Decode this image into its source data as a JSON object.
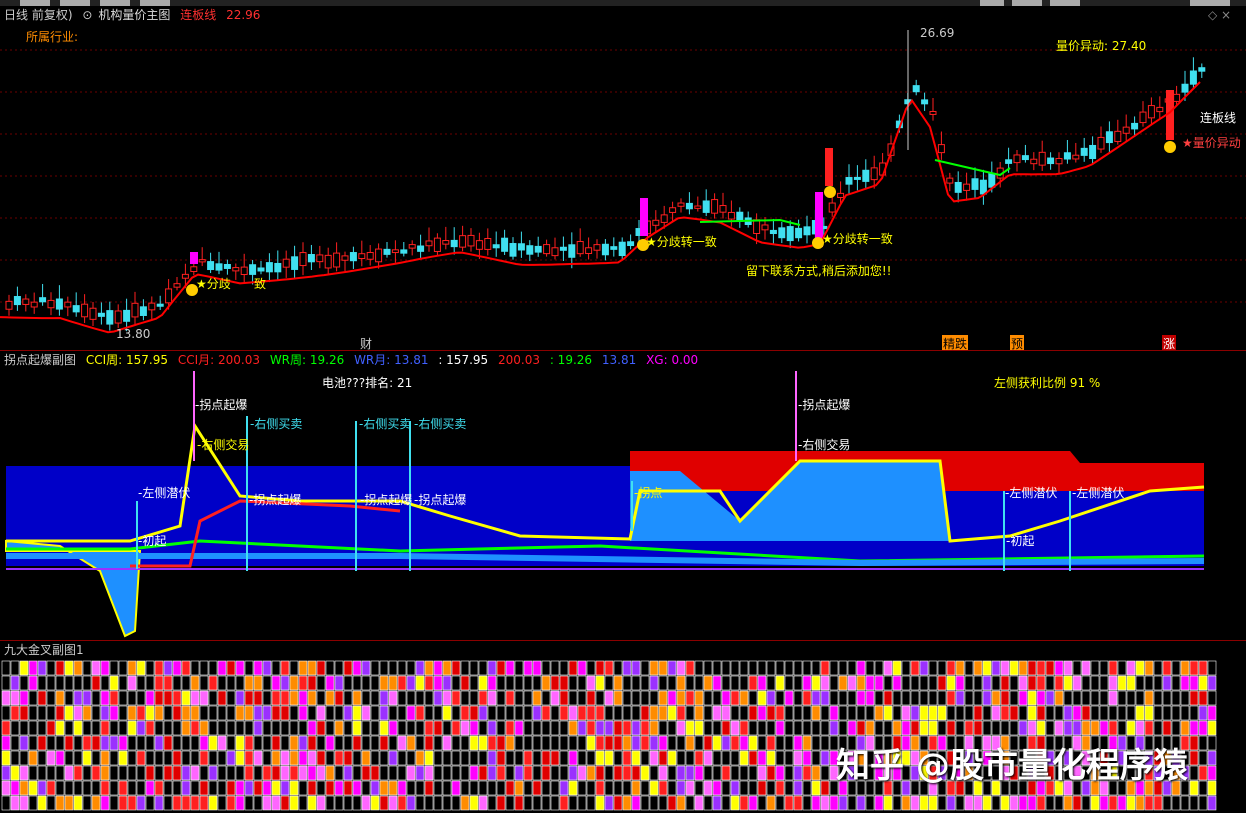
{
  "main": {
    "title_prefix": "日线 前复权)",
    "indicator_name": "机构量价主图",
    "limit_label": "连板线",
    "limit_value": "22.96",
    "industry": "所属行业:",
    "high_price": "26.69",
    "low_price": "13.80",
    "vol_price_label": "量价异动: 27.40",
    "lianban": "连板线",
    "liangjia": "★量价异动",
    "fenqi": "★分歧转一致",
    "fenqi2": "★分歧转一致",
    "fenqi_short": "★分歧",
    "fenqi_short_end": "致",
    "contact": "留下联系方式,稍后添加您!!",
    "axis_tags": [
      "财",
      "精跌",
      "预",
      "涨"
    ]
  },
  "sub1": {
    "name": "拐点起爆副图",
    "cci_week": "CCI周: 157.95",
    "cci_month": "CCI月: 200.03",
    "wr_week": "WR周: 19.26",
    "wr_month": "WR月: 13.81",
    "v1": ": 157.95",
    "v2": "200.03",
    "v3": ": 19.26",
    "v4": "13.81",
    "xg": "XG: 0.00",
    "battery": "电池???排名: 21",
    "left_profit": "左侧获利比例 91 %",
    "tags": [
      "拐点起爆",
      "右侧交易",
      "右侧买卖",
      "右侧买卖",
      "右侧买卖",
      "拐点起爆",
      "拐点起爆",
      "拐点起爆",
      "左侧潜伏",
      "初起",
      "拐点",
      "拐点起爆",
      "右侧交易",
      "左侧潜伏",
      "左侧潜伏",
      "初起"
    ]
  },
  "sub2": {
    "name": "九大金叉副图1",
    "watermark": "知乎 @股市量化程序猿"
  },
  "colors": {
    "up": "#ff2020",
    "down": "#40e0f0",
    "ma_red": "#ff0000",
    "ma_green": "#00ff00",
    "yellow": "#ffff00",
    "blue_fill": "#0000c8",
    "light_blue": "#1e90ff",
    "magenta": "#ff00ff"
  }
}
